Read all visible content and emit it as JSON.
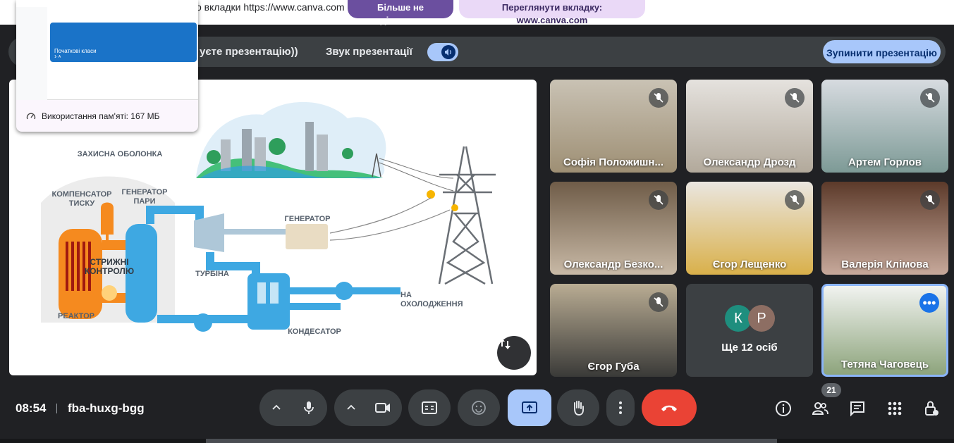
{
  "share_banner": {
    "text": "о вкладки https://www.canva.com",
    "stop_sharing": "Більше не ділитися",
    "view_tab": "Переглянути вкладку: www.canva.com"
  },
  "presentation_bar": {
    "info": "уєте презентацію))",
    "sound_label": "Звук презентації",
    "sound_on": true,
    "stop_label": "Зупинити презентацію"
  },
  "memory_popup": {
    "class_title": "Початкові класи",
    "class_sub": "1- А",
    "usage": "Використання пам'яті: 167 МБ"
  },
  "slide": {
    "labels": {
      "shell": "ЗАХИСНА ОБОЛОНКА",
      "compensator": "КОМПЕНСАТОР ТИСКУ",
      "steam_gen": "ГЕНЕРАТОР ПАРИ",
      "control_rods": "СТРИЖНІ КОНТРОЛЮ",
      "reactor": "РЕАКТОР",
      "turbine": "ТУРБІНА",
      "generator": "ГЕНЕРАТОР",
      "condenser": "КОНДЕСАТОР",
      "cooling": "НА ОХОЛОДЖЕННЯ"
    }
  },
  "participants": [
    {
      "name": "Софія Положишн...",
      "muted": true
    },
    {
      "name": "Олександр Дрозд",
      "muted": true
    },
    {
      "name": "Артем Горлов",
      "muted": true
    },
    {
      "name": "Олександр Безко...",
      "muted": true
    },
    {
      "name": "Єгор Лещенко",
      "muted": true
    },
    {
      "name": "Валерія Клімова",
      "muted": true
    },
    {
      "name": "Єгор Губа",
      "muted": true
    },
    {
      "name": "Тетяна Чаговець",
      "muted": false
    }
  ],
  "more_tile": {
    "avatar_1": "К",
    "avatar_2": "Р",
    "label": "Ще 12 осіб"
  },
  "bottom_bar": {
    "time": "08:54",
    "meeting_code": "fba-huxg-bgg",
    "participant_count": "21"
  },
  "colors": {
    "accent": "#a8c7fa",
    "end_call": "#ea4335",
    "background": "#202124",
    "share_active": "#a8c7fa"
  }
}
